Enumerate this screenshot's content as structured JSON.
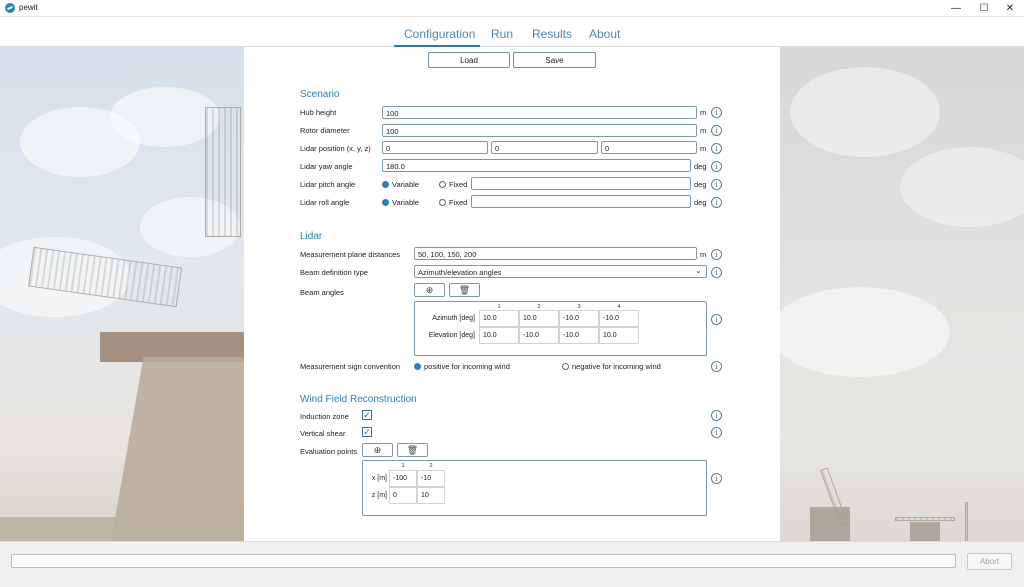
{
  "window": {
    "title": "pewit",
    "minimize_glyph": "—",
    "maximize_glyph": "☐",
    "close_glyph": "✕"
  },
  "nav": {
    "tabs": [
      "Configuration",
      "Run",
      "Results",
      "About"
    ],
    "active": "Configuration"
  },
  "toolbar": {
    "load_label": "Load",
    "save_label": "Save"
  },
  "scenario": {
    "title": "Scenario",
    "hub_height": {
      "label": "Hub height",
      "value": "100",
      "unit": "m"
    },
    "rotor_diameter": {
      "label": "Rotor diameter",
      "value": "100",
      "unit": "m"
    },
    "lidar_position": {
      "label": "Lidar position (x, y, z)",
      "values": [
        "0",
        "0",
        "0"
      ],
      "unit": "m"
    },
    "lidar_yaw": {
      "label": "Lidar yaw angle",
      "value": "180.0",
      "unit": "deg"
    },
    "lidar_pitch": {
      "label": "Lidar pitch angle",
      "option_variable": "Variable",
      "option_fixed": "Fixed",
      "selected": "Variable",
      "fixed_value": "",
      "unit": "deg"
    },
    "lidar_roll": {
      "label": "Lidar roll angle",
      "option_variable": "Variable",
      "option_fixed": "Fixed",
      "selected": "Variable",
      "fixed_value": "",
      "unit": "deg"
    }
  },
  "lidar": {
    "title": "Lidar",
    "measurement_planes": {
      "label": "Measurement plane distances",
      "value": "50, 100, 150, 200",
      "unit": "m"
    },
    "beam_definition": {
      "label": "Beam definition type",
      "value": "Azimuth/elevation angles"
    },
    "beam_angles": {
      "label": "Beam angles",
      "add_icon": "⊕",
      "delete_icon": "🗑",
      "columns": [
        "1",
        "2",
        "3",
        "4"
      ],
      "rows": [
        {
          "label": "Azimuth [deg]",
          "values": [
            "10.0",
            "10.0",
            "-10.0",
            "-10.0"
          ]
        },
        {
          "label": "Elevation [deg]",
          "values": [
            "10.0",
            "-10.0",
            "-10.0",
            "10.0"
          ]
        }
      ]
    },
    "sign_convention": {
      "label": "Measurement sign convention",
      "option_positive": "positive for incoming wind",
      "option_negative": "negative for incoming wind",
      "selected": "positive"
    }
  },
  "wfr": {
    "title": "Wind Field Reconstruction",
    "induction_zone": {
      "label": "Induction zone",
      "checked": true,
      "check_glyph": "✓"
    },
    "vertical_shear": {
      "label": "Vertical shear",
      "checked": true,
      "check_glyph": "✓"
    },
    "evaluation_points": {
      "label": "Evaluation points",
      "add_icon": "⊕",
      "delete_icon": "🗑",
      "columns": [
        "1",
        "2"
      ],
      "rows": [
        {
          "label": "x [m]",
          "values": [
            "-100",
            "-10"
          ]
        },
        {
          "label": "z [m]",
          "values": [
            "0",
            "10"
          ]
        }
      ]
    }
  },
  "info_glyph": "i",
  "dropdown_glyph": "⌄",
  "status": {
    "abort_label": "Abort",
    "progress": 0
  },
  "colors": {
    "accent": "#2f7fb3",
    "tab_text": "#4f86b0",
    "border": "#7d98aa"
  }
}
